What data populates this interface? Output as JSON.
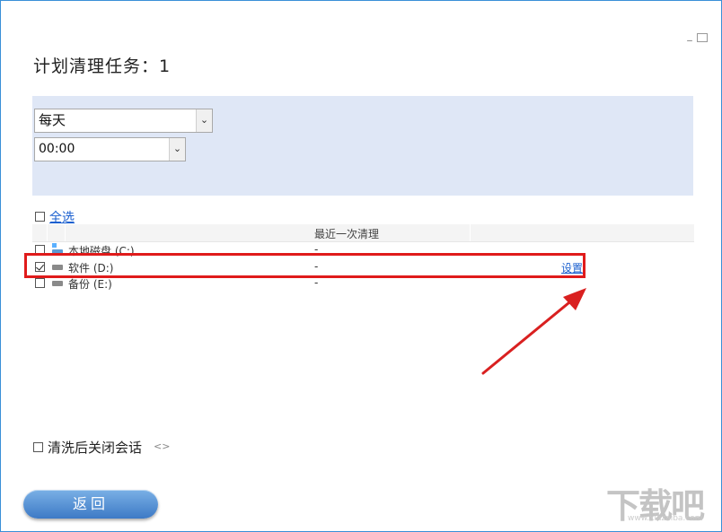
{
  "window": {
    "minimize_icon": "minimize-icon",
    "maximize_icon": "maximize-icon"
  },
  "title": "计划清理任务：1",
  "schedule": {
    "frequency": "每天",
    "time": "00:00"
  },
  "select_all": {
    "checked": false,
    "label": "全选"
  },
  "table": {
    "headers": [
      "",
      "",
      "最近一次清理",
      ""
    ],
    "rows": [
      {
        "checked": false,
        "name": "本地磁盘 (C:)",
        "last_clean": "-",
        "action": "",
        "icon": "system-drive-icon"
      },
      {
        "checked": true,
        "name": "软件 (D:)",
        "last_clean": "-",
        "action": "设置",
        "icon": "drive-icon"
      },
      {
        "checked": false,
        "name": "备份 (E:)",
        "last_clean": "-",
        "action": "",
        "icon": "drive-icon"
      }
    ]
  },
  "close_after_clean": {
    "checked": false,
    "label": "清洗后关闭会话",
    "extra_icon": "code-icon"
  },
  "back_button": "返回",
  "watermark": {
    "text": "下载吧",
    "url": "www.xiazaiba.com"
  },
  "annotation": {
    "highlight_color": "#e01b1b",
    "arrow_color": "#d92020"
  }
}
